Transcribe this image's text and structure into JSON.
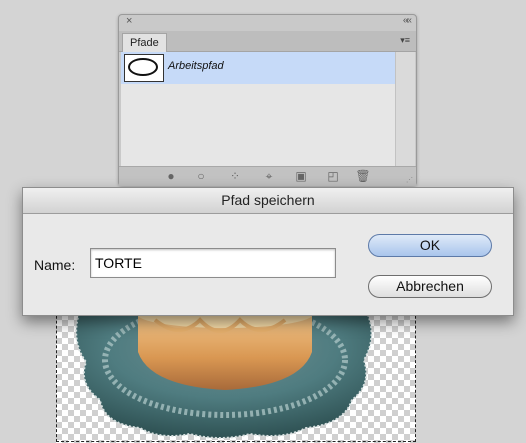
{
  "paths_panel": {
    "close_glyph": "×",
    "collapse_glyph": "««",
    "tab_label": "Pfade",
    "menu_glyph": "▾≡",
    "items": [
      {
        "name": "Arbeitspfad"
      }
    ]
  },
  "dialog": {
    "title": "Pfad speichern",
    "name_label": "Name:",
    "name_value": "TORTE",
    "ok_label": "OK",
    "cancel_label": "Abbrechen"
  },
  "colors": {
    "selection": "#c6daf8",
    "ok_button": "#a9c5ec"
  }
}
